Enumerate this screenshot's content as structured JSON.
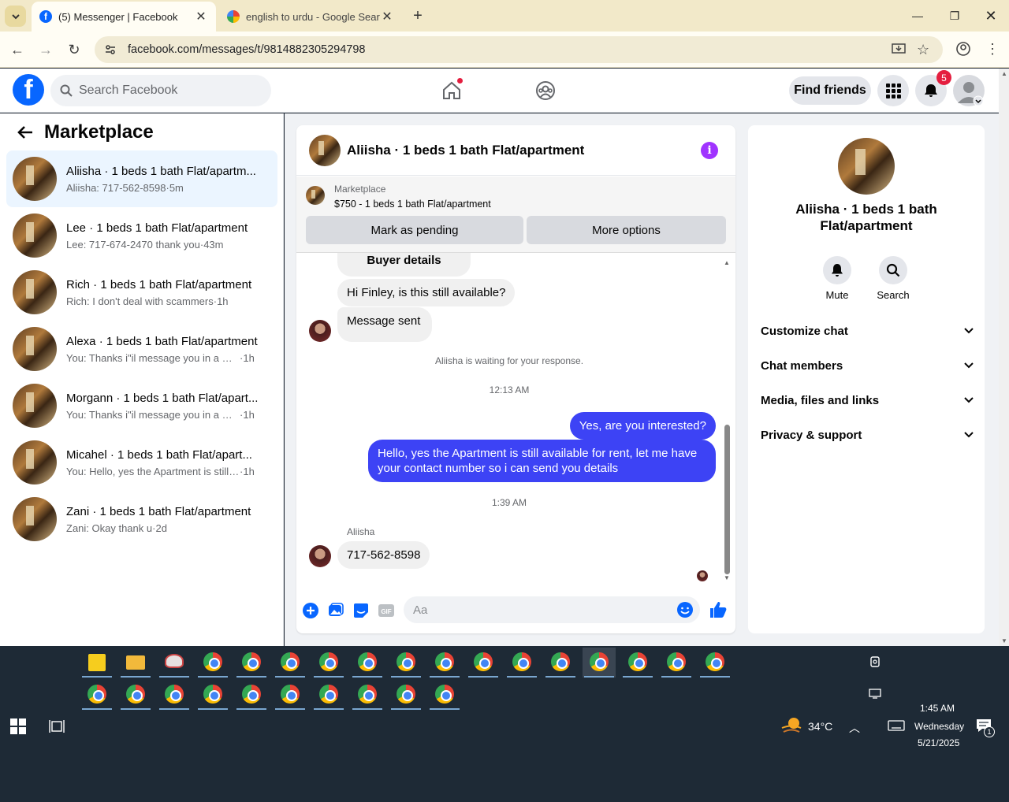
{
  "browser": {
    "tabs": [
      {
        "title": "(5) Messenger | Facebook",
        "icon": "facebook-icon",
        "active": true
      },
      {
        "title": "english to urdu - Google Search",
        "icon": "google-icon",
        "active": false
      }
    ],
    "url": "facebook.com/messages/t/9814882305294798"
  },
  "fb": {
    "search_placeholder": "Search Facebook",
    "find_friends": "Find friends",
    "notification_count": "5"
  },
  "left": {
    "title": "Marketplace",
    "conversations": [
      {
        "name": "Aliisha · 1 beds 1 bath Flat/apartm...",
        "preview": "Aliisha: 717-562-8598",
        "time": "5m",
        "selected": true
      },
      {
        "name": "Lee · 1 beds 1 bath Flat/apartment",
        "preview": "Lee: 717-674-2470 thank you",
        "time": "43m"
      },
      {
        "name": "Rich · 1 beds 1 bath Flat/apartment",
        "preview": "Rich: I don't deal with scammers",
        "time": "1h"
      },
      {
        "name": "Alexa · 1 beds 1 bath Flat/apartment",
        "preview": "You: Thanks i\"il message you in a mo...",
        "time": "1h"
      },
      {
        "name": "Morgann · 1 beds 1 bath Flat/apart...",
        "preview": "You: Thanks i\"il message you in a mo...",
        "time": "1h"
      },
      {
        "name": "Micahel · 1 beds 1 bath Flat/apart...",
        "preview": "You: Hello, yes the Apartment is still a...",
        "time": "1h"
      },
      {
        "name": "Zani · 1 beds 1 bath Flat/apartment",
        "preview": "Zani: Okay thank u",
        "time": "2d"
      }
    ]
  },
  "chat": {
    "title": "Aliisha · 1 beds 1 bath Flat/apartment",
    "marketplace_label": "Marketplace",
    "listing": "$750 - 1 beds 1 bath Flat/apartment",
    "mark_pending": "Mark as pending",
    "more_options": "More options",
    "buyer_details": "Buyer details",
    "msg1": "Hi Finley, is this still available?",
    "msg2": "Message sent",
    "waiting": "Aliisha is waiting for your response.",
    "time1": "12:13 AM",
    "out1": "Yes, are you interested?",
    "out2": "Hello, yes the Apartment is still available for rent, let me have your contact number so i can send you details",
    "time2": "1:39 AM",
    "sender": "Aliisha",
    "msg3": "717-562-8598",
    "composer_placeholder": "Aa"
  },
  "right": {
    "name": "Aliisha · 1 beds 1 bath Flat/apartment",
    "mute": "Mute",
    "search": "Search",
    "sections": [
      "Customize chat",
      "Chat members",
      "Media, files and links",
      "Privacy & support"
    ]
  },
  "taskbar": {
    "temperature": "34°C",
    "time": "1:45 AM",
    "day": "Wednesday",
    "date": "5/21/2025",
    "notif_count": "1"
  },
  "colors": {
    "fb_blue": "#0866ff",
    "outgoing_bubble": "#3d43f5",
    "info_purple": "#a033ff",
    "tab_bar": "#f2e9c9"
  }
}
